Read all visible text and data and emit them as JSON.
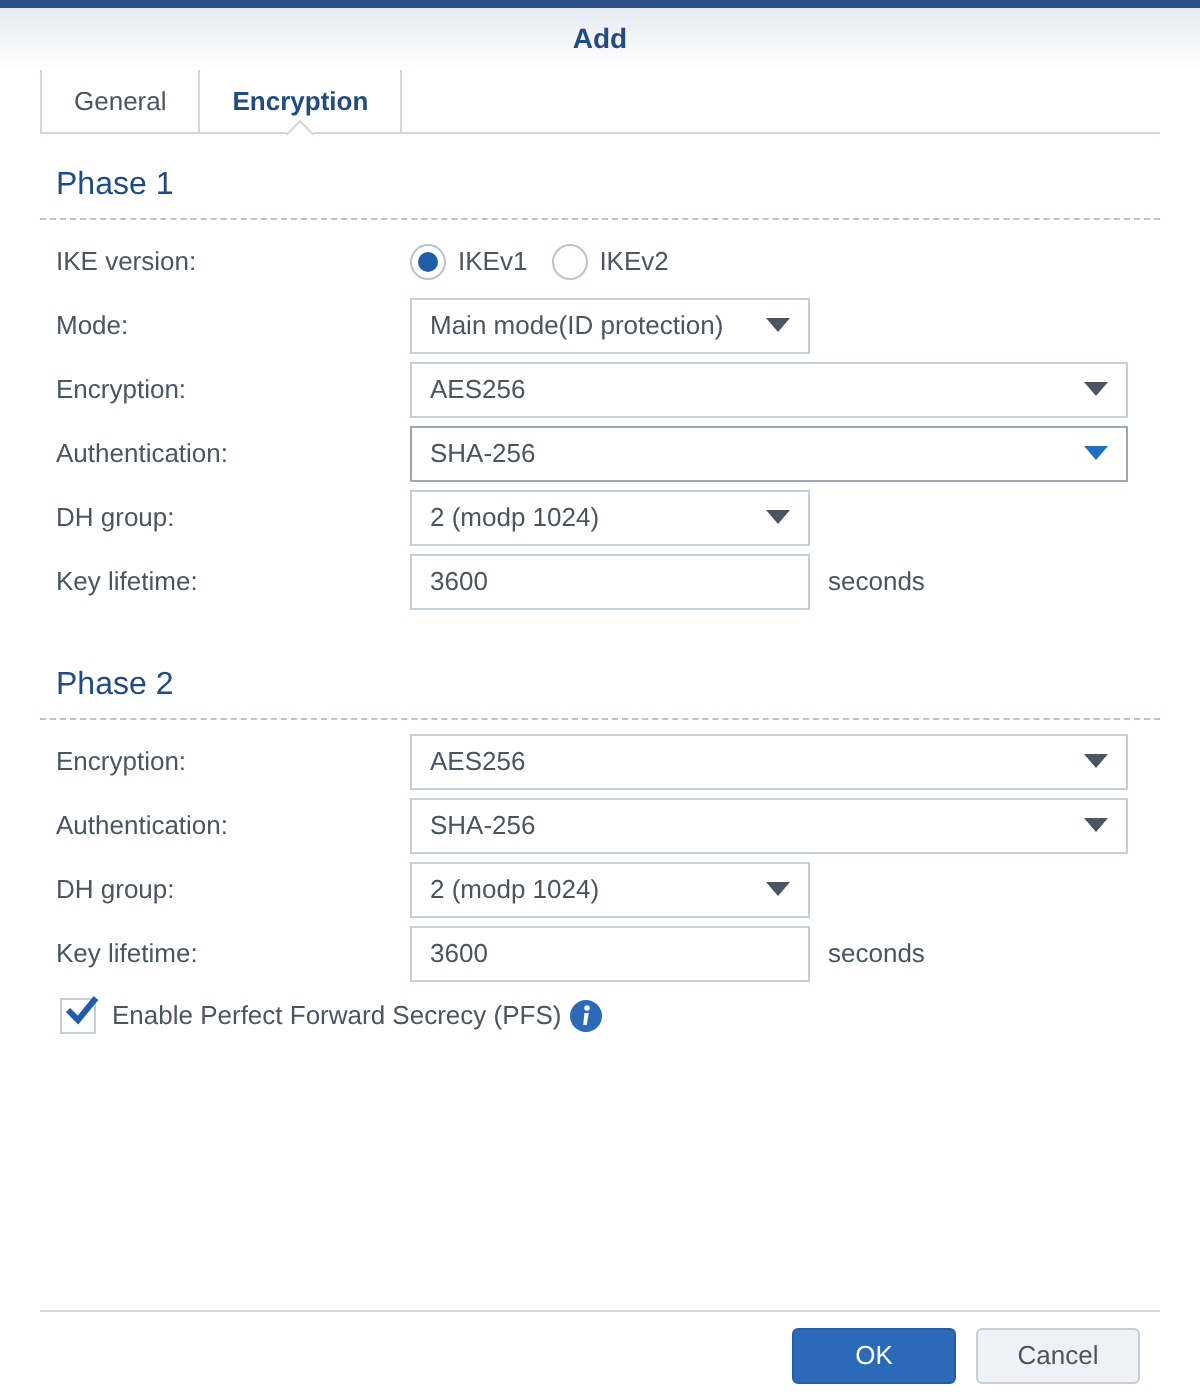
{
  "window": {
    "title": "Add"
  },
  "tabs": [
    {
      "label": "General",
      "selected": false
    },
    {
      "label": "Encryption",
      "selected": true
    }
  ],
  "sections": [
    {
      "title": "Phase 1",
      "fields": [
        {
          "kind": "radio",
          "label": "IKE version:",
          "options": [
            {
              "label": "IKEv1",
              "selected": true
            },
            {
              "label": "IKEv2",
              "selected": false
            }
          ]
        },
        {
          "kind": "short-select",
          "label": "Mode:",
          "value": "Main mode(ID protection)",
          "focused": false
        },
        {
          "kind": "select",
          "label": "Encryption:",
          "value": "AES256",
          "focused": false
        },
        {
          "kind": "select",
          "label": "Authentication:",
          "value": "SHA-256",
          "focused": true
        },
        {
          "kind": "short-select",
          "label": "DH group:",
          "value": "2 (modp 1024)",
          "focused": false
        },
        {
          "kind": "text",
          "label": "Key lifetime:",
          "value": "3600",
          "unit": "seconds"
        }
      ]
    },
    {
      "title": "Phase 2",
      "fields": [
        {
          "kind": "select",
          "label": "Encryption:",
          "value": "AES256",
          "focused": false
        },
        {
          "kind": "select",
          "label": "Authentication:",
          "value": "SHA-256",
          "focused": false
        },
        {
          "kind": "short-select",
          "label": "DH group:",
          "value": "2 (modp 1024)",
          "focused": false
        },
        {
          "kind": "text",
          "label": "Key lifetime:",
          "value": "3600",
          "unit": "seconds"
        }
      ]
    }
  ],
  "pfs": {
    "label": "Enable Perfect Forward Secrecy (PFS)",
    "checked": true
  },
  "buttons": [
    {
      "label": "OK",
      "kind": "primary"
    },
    {
      "label": "Cancel",
      "kind": "secondary"
    }
  ]
}
